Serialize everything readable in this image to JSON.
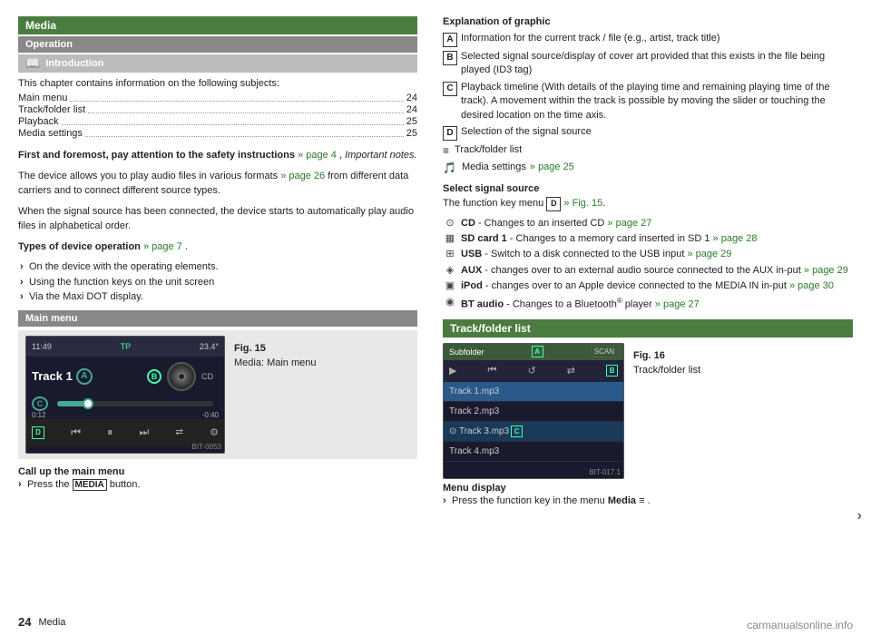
{
  "page": {
    "number": "24",
    "footer_label": "Media"
  },
  "left": {
    "media_header": "Media",
    "operation_header": "Operation",
    "introduction_header": "Introduction",
    "toc_intro": "This chapter contains information on the following subjects:",
    "toc_items": [
      {
        "label": "Main menu",
        "page": "24"
      },
      {
        "label": "Track/folder list",
        "page": "24"
      },
      {
        "label": "Playback",
        "page": "25"
      },
      {
        "label": "Media settings",
        "page": "25"
      }
    ],
    "bold_safety": "First and foremost, pay attention to the safety instructions",
    "safety_link": "» page 4",
    "safety_suffix": ", Important notes.",
    "para1": "The device allows you to play audio files in various formats",
    "para1_link": "» page 26",
    "para1_suffix": " from different data carriers and to connect different source types.",
    "para2": "When the signal source has been connected, the device starts to automatically play audio files in alphabetical order.",
    "types_bold": "Types of device operation",
    "types_link": "» page 7",
    "types_items": [
      "On the device with the operating elements.",
      "Using the function keys on the unit screen",
      "Via the Maxi DOT display."
    ],
    "main_menu_header": "Main menu",
    "fig15_num": "Fig. 15",
    "fig15_label": "Media: Main menu",
    "call_up": "Call up the main menu",
    "call_up_item": "Press the",
    "media_button_label": "MEDIA",
    "call_up_suffix": "button.",
    "skoda_ui": {
      "time_left": "11:49",
      "tp_label": "TP",
      "temp": "23.4°",
      "track_label": "Track 1",
      "badge_a": "A",
      "badge_b": "B",
      "badge_c": "C",
      "badge_d": "D",
      "progress_left": "0:12",
      "progress_right": "-0:40",
      "cd_label": "CD",
      "bit_label": "BIT-0053"
    }
  },
  "right": {
    "explanation_title": "Explanation of graphic",
    "explanations": [
      {
        "badge": "A",
        "text": "Information for the current track / file (e.g., artist, track title)"
      },
      {
        "badge": "B",
        "text": "Selected signal source/display of cover art provided that this exists in the file being played (ID3 tag)"
      },
      {
        "badge": "C",
        "text": "Playback timeline (With details of the playing time and remaining playing time of the track). A movement within the track is possible by moving the slider or touching the desired location on the time axis."
      },
      {
        "badge": "D",
        "text": "Selection of the signal source"
      }
    ],
    "track_folder_line": "Track/folder list",
    "media_settings_line": "Media settings",
    "page25_link1": "» page 25",
    "select_signal_title": "Select signal source",
    "select_signal_intro": "The function key menu",
    "select_badge_d": "D",
    "select_fig": "» Fig. 15",
    "signal_sources": [
      {
        "icon": "⊙",
        "label": "CD",
        "text": "- Changes to an inserted CD",
        "link": "» page 27"
      },
      {
        "icon": "▦",
        "label": "SD card 1",
        "text": "- Changes to a memory card inserted in SD 1",
        "link": "» page 28"
      },
      {
        "icon": "⊞",
        "label": "USB",
        "text": "- Switch to a disk connected to the USB input",
        "link": "» page 29"
      },
      {
        "icon": "◈",
        "label": "AUX",
        "text": "- changes over to an external audio source connected to the AUX input",
        "link": "» page 29"
      },
      {
        "icon": "▣",
        "label": "iPod",
        "text": "- changes over to an Apple device connected to the MEDIA IN input",
        "link": "» page 30"
      },
      {
        "icon": "◉",
        "label": "BT audio",
        "text": "- Changes to a Bluetooth® player",
        "link": "» page 27"
      }
    ],
    "track_folder_header": "Track/folder list",
    "fig16_num": "Fig. 16",
    "fig16_label": "Track/folder list",
    "track_ui": {
      "subfolder_label": "Subfolder",
      "badge_a": "A",
      "badge_b": "B",
      "badge_c": "C",
      "scan_label": "SCAN",
      "tracks": [
        {
          "label": "Track 1.mp3",
          "type": "active"
        },
        {
          "label": "Track 2.mp3",
          "type": "normal"
        },
        {
          "label": "Track 3.mp3",
          "type": "selected"
        },
        {
          "label": "Track 4.mp3",
          "type": "normal"
        }
      ],
      "bit_label": "BIT-017.1"
    },
    "menu_display_title": "Menu display",
    "menu_display_text": "Press the function key in the menu Media",
    "menu_icon": "≡",
    "menu_suffix": ".",
    "right_arrow": "›"
  }
}
